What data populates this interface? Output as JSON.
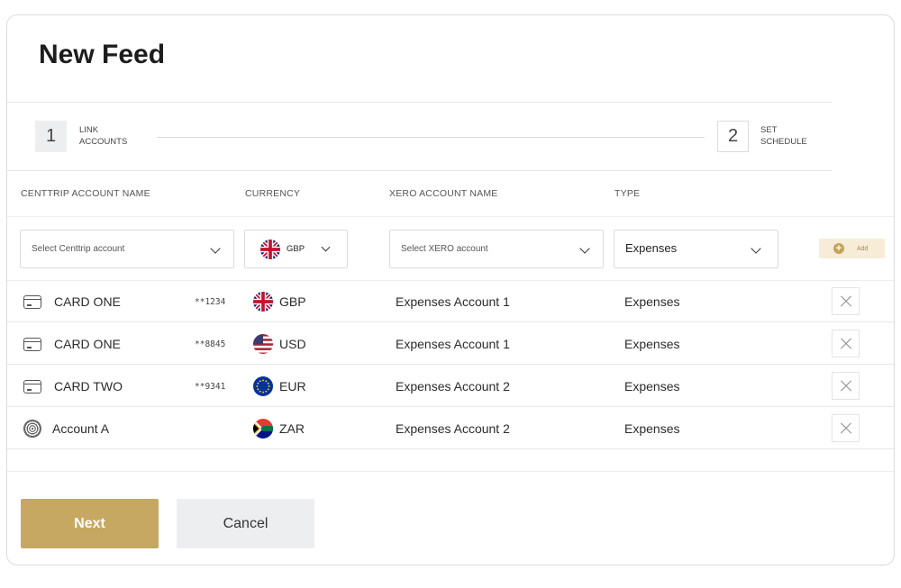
{
  "title": "New Feed",
  "steps": [
    {
      "number": "1",
      "label": "LINK\nACCOUNTS"
    },
    {
      "number": "2",
      "label": "SET\nSCHEDULE"
    }
  ],
  "columns": {
    "account": "CENTTRIP ACCOUNT NAME",
    "currency": "CURRENCY",
    "xero": "XERO ACCOUNT NAME",
    "type": "TYPE"
  },
  "form": {
    "centtrip_placeholder": "Select Centtrip account",
    "currency_value": "GBP",
    "currency_flag": "uk-flag-icon",
    "xero_placeholder": "Select XERO account",
    "type_value": "Expenses",
    "add_label": "Add"
  },
  "rows": [
    {
      "icon": "card-icon",
      "name": "CARD ONE",
      "masked": "**1234",
      "flag": "uk-flag-icon",
      "currency": "GBP",
      "xero": "Expenses Account 1",
      "type": "Expenses"
    },
    {
      "icon": "card-icon",
      "name": "CARD ONE",
      "masked": "**8845",
      "flag": "us-flag-icon",
      "currency": "USD",
      "xero": "Expenses Account 1",
      "type": "Expenses"
    },
    {
      "icon": "card-icon",
      "name": "CARD TWO",
      "masked": "**9341",
      "flag": "eu-flag-icon",
      "currency": "EUR",
      "xero": "Expenses Account 2",
      "type": "Expenses"
    },
    {
      "icon": "account-icon",
      "name": "Account A",
      "masked": "",
      "flag": "za-flag-icon",
      "currency": "ZAR",
      "xero": "Expenses Account 2",
      "type": "Expenses"
    }
  ],
  "buttons": {
    "next": "Next",
    "cancel": "Cancel"
  },
  "colors": {
    "accent": "#c6a862",
    "accent_light": "#f7ecd7",
    "neutral": "#eceeef"
  }
}
